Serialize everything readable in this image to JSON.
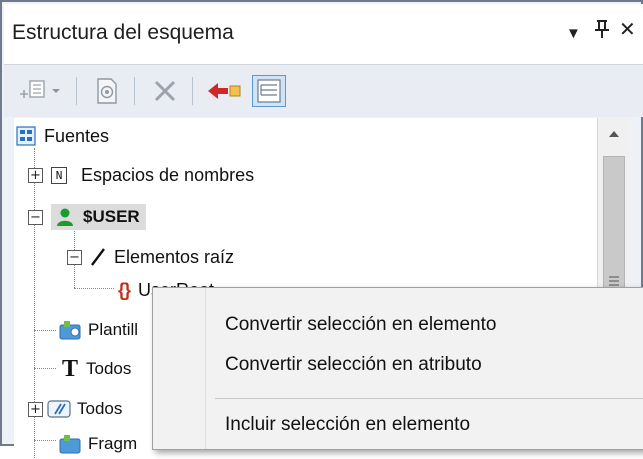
{
  "panel": {
    "title": "Estructura del esquema",
    "dropdown_glyph": "▼",
    "pin_glyph": "🖈",
    "close_glyph": "✕"
  },
  "toolbar": {
    "icons": [
      "add-element-icon",
      "dropdown-arrow-icon",
      "schema-icon",
      "delete-icon",
      "back-arrow-icon",
      "tree-view-icon"
    ]
  },
  "tree": {
    "items": [
      {
        "label": "Fuentes",
        "icon": "sources-icon"
      },
      {
        "label": "Espacios de nombres",
        "icon": "namespace-icon",
        "expander": "+"
      },
      {
        "label": "$USER",
        "icon": "user-icon",
        "expander": "−"
      },
      {
        "label": "Elementos raíz",
        "icon": "slash-icon",
        "expander": "−"
      },
      {
        "label": "UserRoot",
        "icon": "braces-icon"
      },
      {
        "label": "Plantill",
        "icon": "template-icon"
      },
      {
        "label": "Todos",
        "icon": "text-T-icon"
      },
      {
        "label": "Todos",
        "icon": "all-elements-icon",
        "expander": "+"
      },
      {
        "label": "Fragm",
        "icon": "fragment-icon"
      }
    ],
    "namespace_glyph": "N",
    "text_glyph": "T",
    "braces_glyph": "{}"
  },
  "context_menu": {
    "items": [
      "Convertir selección en elemento",
      "Convertir selección en atributo",
      "Incluir selección en elemento"
    ]
  },
  "colors": {
    "accent_blue": "#2b6fb8",
    "user_green": "#1a9d2c",
    "delete_red": "#c92626",
    "braces_red": "#c0301c"
  }
}
